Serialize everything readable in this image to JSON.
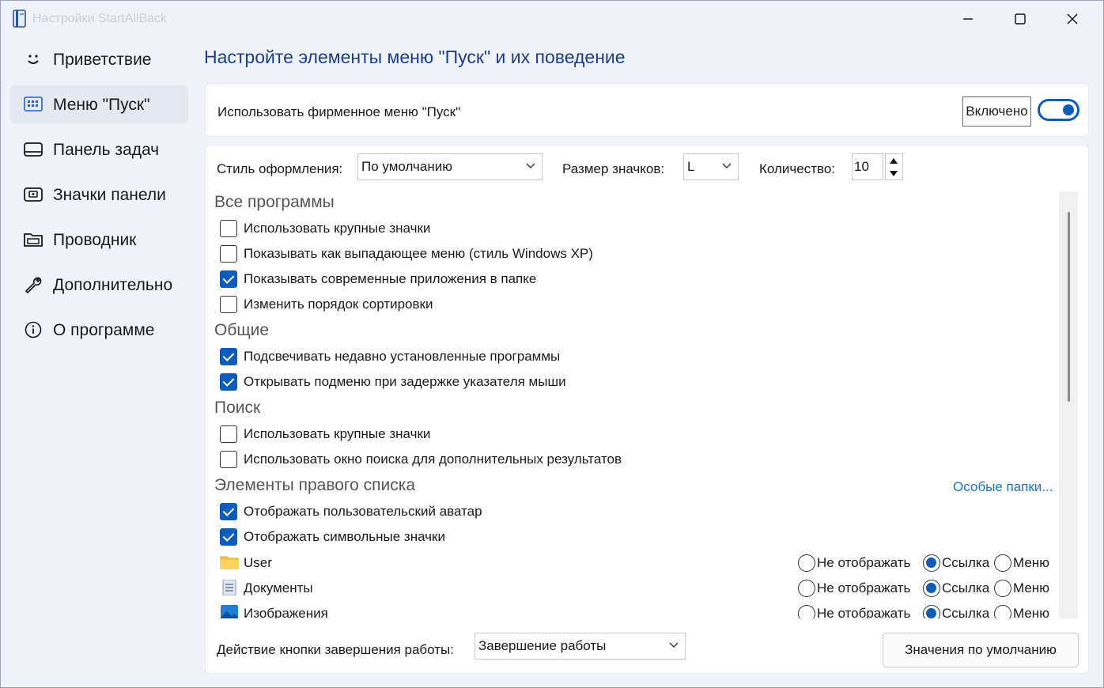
{
  "window": {
    "title": "Настройки StartAllBack"
  },
  "sidebar": {
    "items": [
      {
        "label": "Приветствие",
        "icon": "smile-icon"
      },
      {
        "label": "Меню \"Пуск\"",
        "icon": "start-menu-icon",
        "active": true
      },
      {
        "label": "Панель задач",
        "icon": "taskbar-icon"
      },
      {
        "label": "Значки панели",
        "icon": "tray-icon"
      },
      {
        "label": "Проводник",
        "icon": "explorer-icon"
      },
      {
        "label": "Дополнительно",
        "icon": "wrench-icon"
      },
      {
        "label": "О программе",
        "icon": "info-icon"
      }
    ]
  },
  "main": {
    "title": "Настройте элементы меню \"Пуск\" и их поведение",
    "use_branded": {
      "label": "Использовать фирменное меню \"Пуск\"",
      "state_label": "Включено",
      "toggle_on": true
    },
    "style": {
      "label": "Стиль оформления:",
      "value": "По умолчанию"
    },
    "icon_size": {
      "label": "Размер значков:",
      "value": "L"
    },
    "count": {
      "label": "Количество:",
      "value": "10"
    },
    "sections": {
      "all_programs": {
        "title": "Все программы",
        "options": [
          {
            "label": "Использовать крупные значки",
            "checked": false
          },
          {
            "label": "Показывать как выпадающее меню (стиль Windows XP)",
            "checked": false
          },
          {
            "label": "Показывать современные приложения в папке",
            "checked": true
          },
          {
            "label": "Изменить порядок сортировки",
            "checked": false
          }
        ]
      },
      "general": {
        "title": "Общие",
        "options": [
          {
            "label": "Подсвечивать недавно установленные программы",
            "checked": true
          },
          {
            "label": "Открывать подменю при задержке указателя мыши",
            "checked": true
          }
        ]
      },
      "search": {
        "title": "Поиск",
        "options": [
          {
            "label": "Использовать крупные значки",
            "checked": false
          },
          {
            "label": "Использовать окно поиска для дополнительных результатов",
            "checked": false
          }
        ]
      },
      "right_list": {
        "title": "Элементы правого списка",
        "link": "Особые папки...",
        "options": [
          {
            "label": "Отображать пользовательский аватар",
            "checked": true
          },
          {
            "label": "Отображать символьные значки",
            "checked": true
          }
        ],
        "radio_labels": {
          "hide": "Не отображать",
          "link": "Ссылка",
          "menu": "Меню"
        },
        "folders": [
          {
            "name": "User",
            "icon": "user-folder-icon",
            "selected": "link"
          },
          {
            "name": "Документы",
            "icon": "documents-icon",
            "selected": "link"
          },
          {
            "name": "Изображения",
            "icon": "pictures-icon",
            "selected": "link"
          }
        ]
      }
    },
    "shutdown": {
      "label": "Действие кнопки завершения работы:",
      "value": "Завершение работы"
    },
    "defaults_button": "Значения по умолчанию"
  },
  "colors": {
    "accent": "#0b5cbd",
    "title": "#1b3e8c",
    "link": "#1a73c4",
    "background": "#f0f3f9"
  }
}
